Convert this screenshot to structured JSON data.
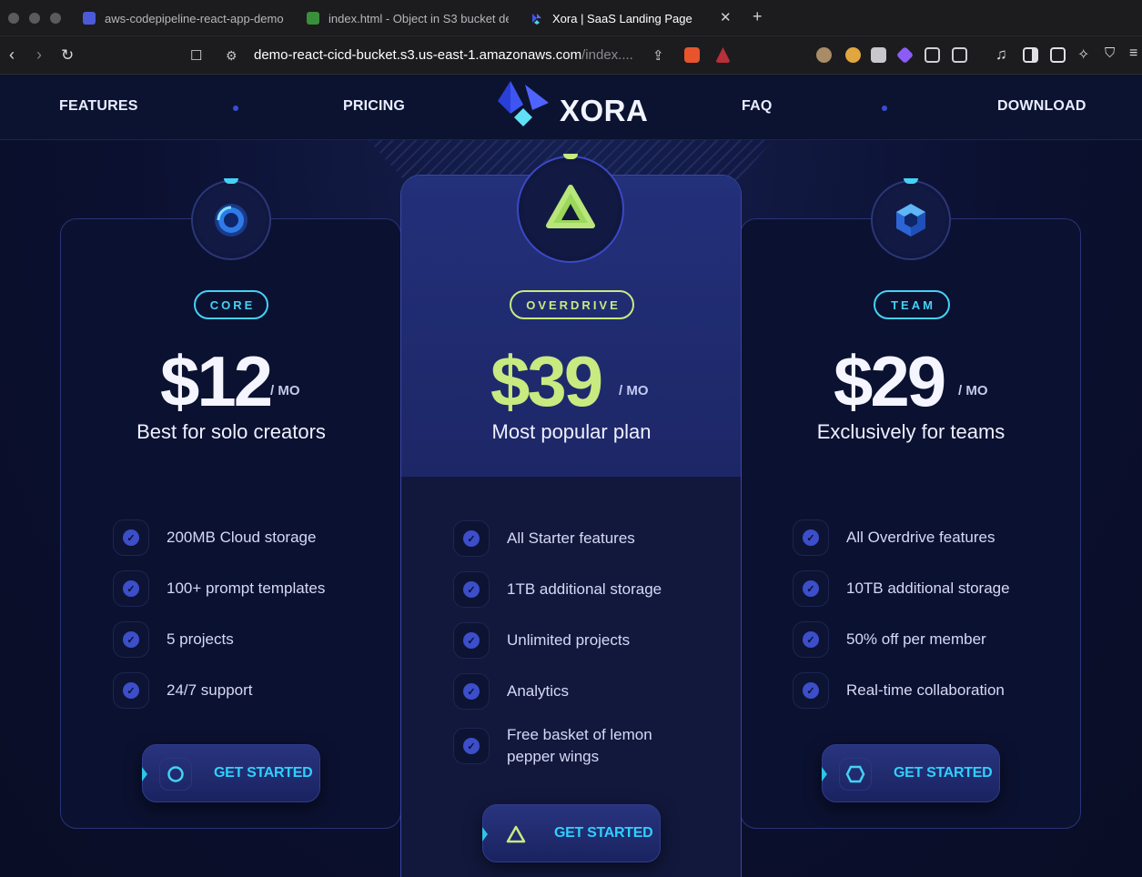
{
  "browser": {
    "tabs": [
      {
        "title": "aws-codepipeline-react-app-demo",
        "active": false
      },
      {
        "title": "index.html - Object in S3 bucket de",
        "active": false
      },
      {
        "title": "Xora | SaaS Landing Page",
        "active": true
      }
    ],
    "url_host": "demo-react-cicd-bucket.s3.us-east-1.amazonaws.com",
    "url_path": "/index...."
  },
  "nav": {
    "links": [
      "FEATURES",
      "PRICING",
      "FAQ",
      "DOWNLOAD"
    ],
    "logo_text": "XORA"
  },
  "plans": [
    {
      "name": "CORE",
      "price": "$12",
      "per": "/ MO",
      "tagline": "Best for solo creators",
      "features": [
        "200MB Cloud storage",
        "100+ prompt templates",
        "5 projects",
        "24/7 support"
      ],
      "cta": "GET STARTED",
      "accent": "#45d1f5"
    },
    {
      "name": "OVERDRIVE",
      "price": "$39",
      "per": "/ MO",
      "tagline": "Most popular plan",
      "features": [
        "All Starter features",
        "1TB additional storage",
        "Unlimited projects",
        "Analytics",
        "Free basket of lemon pepper wings"
      ],
      "cta": "GET STARTED",
      "accent": "#c8ea80"
    },
    {
      "name": "TEAM",
      "price": "$29",
      "per": "/ MO",
      "tagline": "Exclusively for teams",
      "features": [
        "All Overdrive features",
        "10TB additional storage",
        "50% off per member",
        "Real-time collaboration"
      ],
      "cta": "GET STARTED",
      "accent": "#45d1f5"
    }
  ],
  "colors": {
    "page_bg": "#0a0e28",
    "card_border": "#2a3478",
    "center_card_top": "#23307a",
    "cta_text": "#2fd0ff",
    "check_fill": "#3c4ec9"
  }
}
